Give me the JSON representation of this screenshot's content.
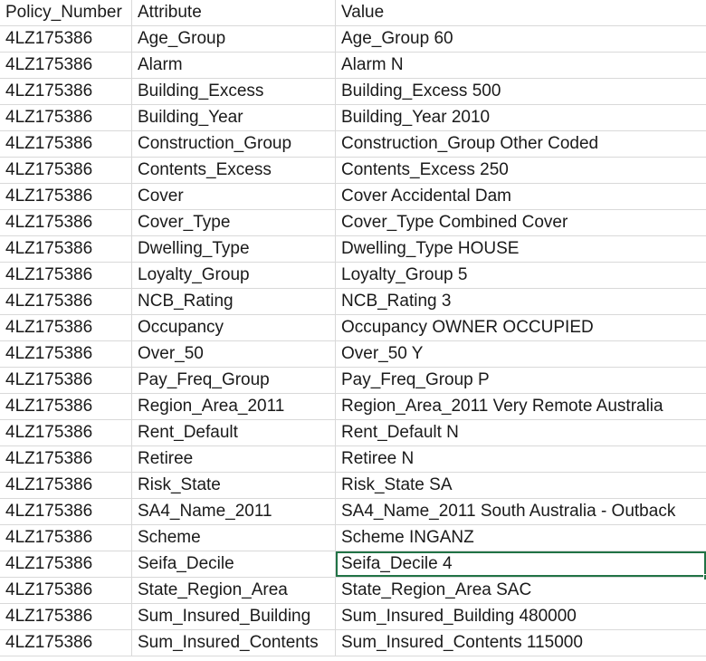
{
  "headers": {
    "policy_number": "Policy_Number",
    "attribute": "Attribute",
    "value": "Value"
  },
  "selected_row_index": 20,
  "accent_color": "#217346",
  "rows": [
    {
      "policy": "4LZ175386",
      "attribute": "Age_Group",
      "value": "Age_Group 60"
    },
    {
      "policy": "4LZ175386",
      "attribute": "Alarm",
      "value": "Alarm N"
    },
    {
      "policy": "4LZ175386",
      "attribute": "Building_Excess",
      "value": "Building_Excess 500"
    },
    {
      "policy": "4LZ175386",
      "attribute": "Building_Year",
      "value": "Building_Year 2010"
    },
    {
      "policy": "4LZ175386",
      "attribute": "Construction_Group",
      "value": "Construction_Group Other Coded"
    },
    {
      "policy": "4LZ175386",
      "attribute": "Contents_Excess",
      "value": "Contents_Excess 250"
    },
    {
      "policy": "4LZ175386",
      "attribute": "Cover",
      "value": "Cover Accidental Dam"
    },
    {
      "policy": "4LZ175386",
      "attribute": "Cover_Type",
      "value": "Cover_Type Combined Cover"
    },
    {
      "policy": "4LZ175386",
      "attribute": "Dwelling_Type",
      "value": "Dwelling_Type HOUSE"
    },
    {
      "policy": "4LZ175386",
      "attribute": "Loyalty_Group",
      "value": "Loyalty_Group 5"
    },
    {
      "policy": "4LZ175386",
      "attribute": "NCB_Rating",
      "value": "NCB_Rating 3"
    },
    {
      "policy": "4LZ175386",
      "attribute": "Occupancy",
      "value": "Occupancy OWNER OCCUPIED"
    },
    {
      "policy": "4LZ175386",
      "attribute": "Over_50",
      "value": "Over_50 Y"
    },
    {
      "policy": "4LZ175386",
      "attribute": "Pay_Freq_Group",
      "value": "Pay_Freq_Group P"
    },
    {
      "policy": "4LZ175386",
      "attribute": "Region_Area_2011",
      "value": "Region_Area_2011 Very Remote Australia"
    },
    {
      "policy": "4LZ175386",
      "attribute": "Rent_Default",
      "value": "Rent_Default N"
    },
    {
      "policy": "4LZ175386",
      "attribute": "Retiree",
      "value": "Retiree N"
    },
    {
      "policy": "4LZ175386",
      "attribute": "Risk_State",
      "value": "Risk_State SA"
    },
    {
      "policy": "4LZ175386",
      "attribute": "SA4_Name_2011",
      "value": "SA4_Name_2011 South Australia - Outback"
    },
    {
      "policy": "4LZ175386",
      "attribute": "Scheme",
      "value": "Scheme INGANZ"
    },
    {
      "policy": "4LZ175386",
      "attribute": "Seifa_Decile",
      "value": "Seifa_Decile 4"
    },
    {
      "policy": "4LZ175386",
      "attribute": "State_Region_Area",
      "value": "State_Region_Area SAC"
    },
    {
      "policy": "4LZ175386",
      "attribute": "Sum_Insured_Building",
      "value": "Sum_Insured_Building 480000"
    },
    {
      "policy": "4LZ175386",
      "attribute": "Sum_Insured_Contents",
      "value": "Sum_Insured_Contents 115000"
    }
  ]
}
